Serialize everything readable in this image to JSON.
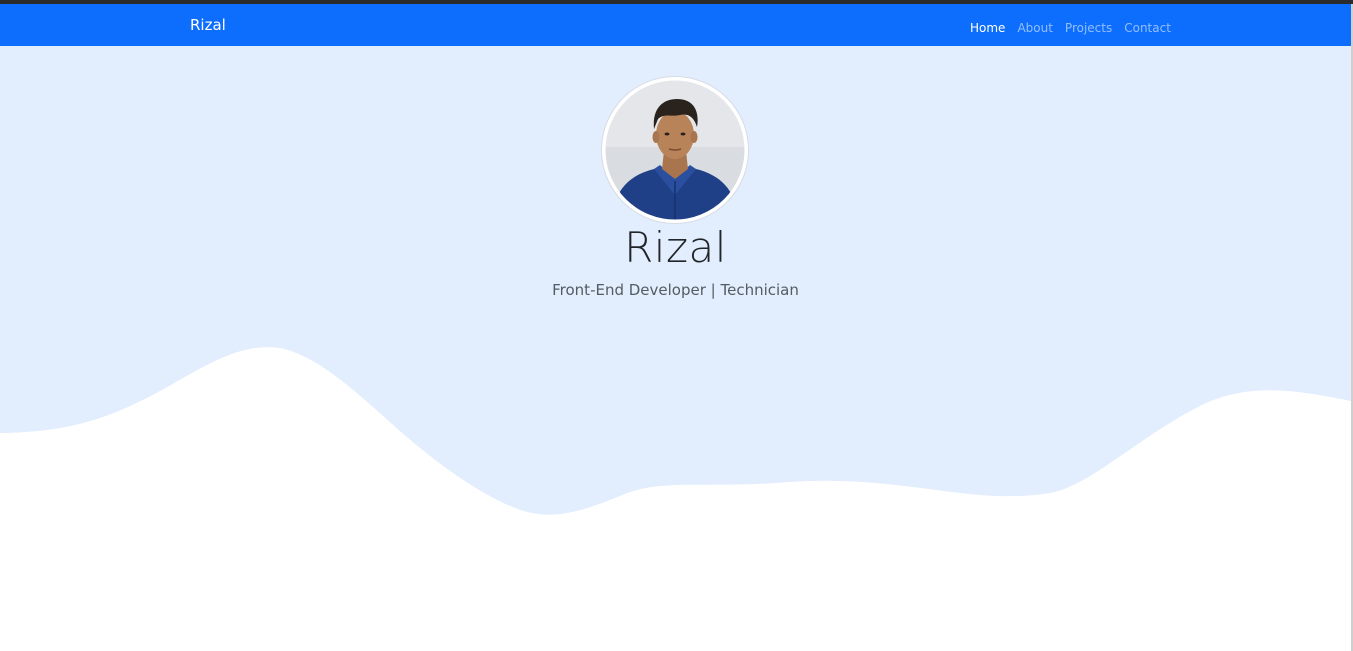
{
  "navbar": {
    "brand": "Rizal",
    "links": [
      {
        "label": "Home",
        "active": true
      },
      {
        "label": "About",
        "active": false
      },
      {
        "label": "Projects",
        "active": false
      },
      {
        "label": "Contact",
        "active": false
      }
    ]
  },
  "hero": {
    "name": "Rizal",
    "subtitle": "Front-End Developer | Technician",
    "avatar_icon": "profile-photo"
  },
  "colors": {
    "navbar_bg": "#0d6efd",
    "hero_bg": "#e2edfd",
    "wave": "#ffffff"
  }
}
